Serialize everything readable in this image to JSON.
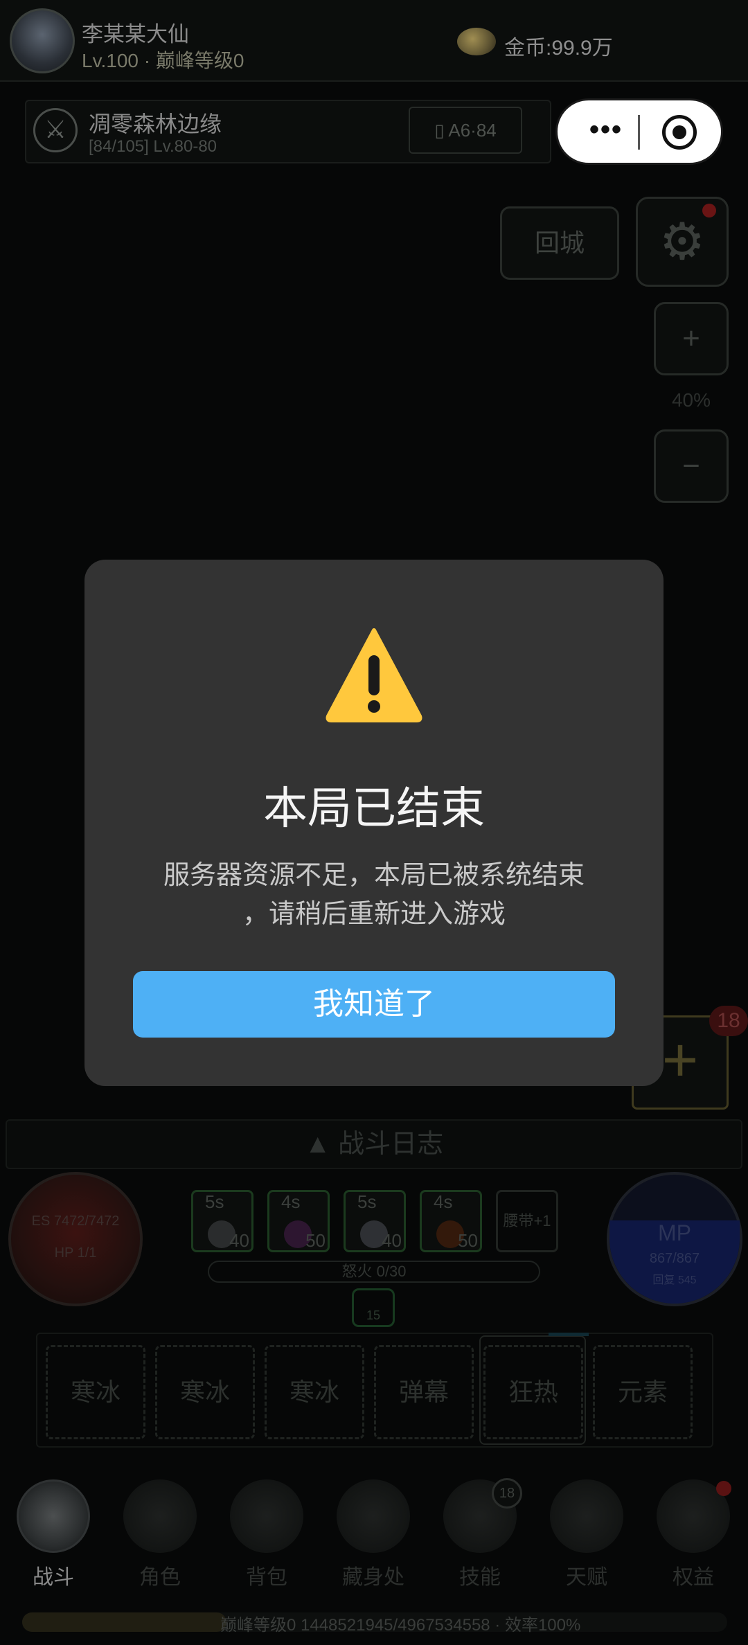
{
  "player": {
    "name": "李某某大仙",
    "level": "Lv.100 · 巅峰等级0",
    "gold": "金币:99.9万"
  },
  "location": {
    "name": "凋零森林边缘",
    "sub": "[84/105] Lv.80-80",
    "map_code": "A6·84"
  },
  "capsule": {
    "more": "•••"
  },
  "controls": {
    "return_label": "回城",
    "gear_glyph": "⚙",
    "zoom_in": "+",
    "zoom_level": "40%",
    "zoom_out": "−",
    "add_glyph": "+",
    "add_badge": "18"
  },
  "battle_log": "▲ 战斗日志",
  "hp_orb": {
    "es": "ES 7472/7472",
    "hp": "HP 1/1"
  },
  "mp_orb": {
    "label": "MP",
    "value": "867/867",
    "sub": "回复 545"
  },
  "buffs": [
    {
      "time": "5s",
      "count": "40",
      "color": "#6a6e70"
    },
    {
      "time": "4s",
      "count": "50",
      "color": "#6b2a6a"
    },
    {
      "time": "5s",
      "count": "40",
      "color": "#7a7e86"
    },
    {
      "time": "4s",
      "count": "50",
      "color": "#7a3a14"
    }
  ],
  "belt": "腰带+1",
  "rage": "怒火 0/30",
  "stance": "15",
  "skills": [
    "寒冰",
    "寒冰",
    "寒冰",
    "弹幕",
    "狂热",
    "元素"
  ],
  "nav": [
    {
      "label": "战斗"
    },
    {
      "label": "角色"
    },
    {
      "label": "背包"
    },
    {
      "label": "藏身处"
    },
    {
      "label": "技能"
    },
    {
      "label": "天赋"
    },
    {
      "label": "权益"
    }
  ],
  "nav_badge": "18",
  "xp": {
    "text": "巅峰等级0  1448521945/4967534558 · 效率100%",
    "progress": 0.29
  },
  "modal": {
    "title": "本局已结束",
    "message_line1": "服务器资源不足，本局已被系统结束",
    "message_line2": "，请稍后重新进入游戏",
    "button": "我知道了"
  },
  "colors": {
    "accent": "#4eb0f5",
    "modal_bg": "#333333",
    "warning": "#ffc83d"
  }
}
